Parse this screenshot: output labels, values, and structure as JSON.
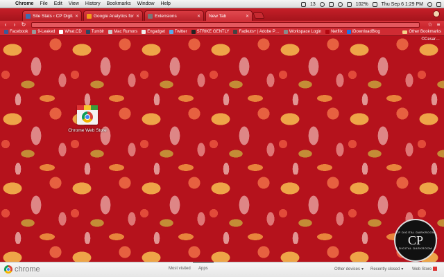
{
  "menubar": {
    "app_name": "Chrome",
    "items": [
      "File",
      "Edit",
      "View",
      "History",
      "Bookmarks",
      "Window",
      "Help"
    ],
    "status": {
      "notifications": "13",
      "battery": "102%",
      "clock": "Thu Sep 6  1:29 PM"
    }
  },
  "tabs": [
    {
      "title": "Site Stats ‹ CP Digital Darkroom",
      "color": "#3b6db3"
    },
    {
      "title": "Google Analytics for WordPress",
      "color": "#f29d1a"
    },
    {
      "title": "Extensions",
      "color": "#777777"
    },
    {
      "title": "New Tab",
      "color": "#eeeeee"
    }
  ],
  "bookmarks": {
    "items": [
      "Facebook",
      "9-Leaked",
      "What.CD",
      "Tumblr",
      "Mac Rumors",
      "Engadget",
      "Twitter",
      "STRIKE GENTLY",
      "Fadkuts+ | Adobe P…",
      "Workspace Login",
      "Netflix",
      "iDownloadBlog"
    ],
    "other": "Other Bookmarks"
  },
  "ntp": {
    "credit": "©Cesar…",
    "apps": [
      {
        "label": "Chrome Web Store"
      }
    ],
    "badge": {
      "ring_top": "CP DIGITAL DARKROOM",
      "monogram": "CP",
      "ring_bottom": "DIGITAL DARKROOM"
    }
  },
  "footer": {
    "brand": "chrome",
    "tabs": [
      "Most visited",
      "Apps"
    ],
    "other_devices": "Other devices",
    "recently_closed": "Recently closed",
    "web_store": "Web Store"
  },
  "theme_colors": {
    "frame": "#c51f28",
    "background": "#b5121c",
    "accent_petal": "#f8be50"
  }
}
